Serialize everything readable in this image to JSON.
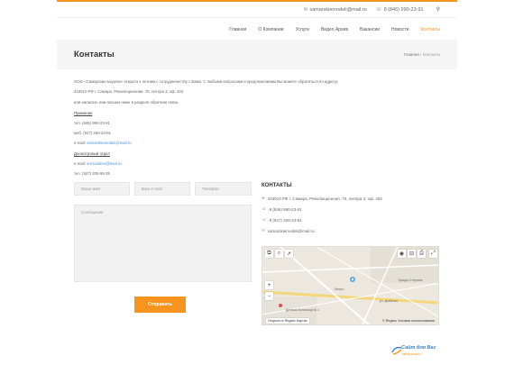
{
  "colors": {
    "accent": "#f7941d",
    "link": "#4a90d9",
    "heading": "#333333"
  },
  "topbar": {
    "email": "samarskiemodeli@mail.ru",
    "phone": "8 (846) 990-23-91",
    "email_icon": "envelope-icon",
    "phone_icon": "phone-icon",
    "search_icon": "search-icon"
  },
  "nav": {
    "items": [
      {
        "label": "Главная"
      },
      {
        "label": "О Компании"
      },
      {
        "label": "Услуги"
      },
      {
        "label": "Видео Архив"
      },
      {
        "label": "Вакансии"
      },
      {
        "label": "Новости"
      },
      {
        "label": "Контакты"
      }
    ],
    "active_index": 6
  },
  "page": {
    "title": "Контакты",
    "breadcrumb": {
      "home": "Главная",
      "separator": "/",
      "current": "Контакты"
    }
  },
  "content": {
    "intro": "ООО «Самарские модели» открыто к летним с сотрудничеству с Вами. С любыми вопросами и предложениями Вы можете обратиться по адресу:",
    "address": "443010 РФ г. Самара, Революционная, 70, литера 3, оф. 402",
    "write_hint": "или написать нам письмо ниже в разделе обратная связь.",
    "section1_title": "Приемная",
    "tel1": "тел. (846) 990-23-91",
    "mob1": "моб. (927) 260-23-91",
    "email1_prefix": "e-mail:",
    "email1": "samarskiemodeli@mail.ru",
    "section2_title": "Досмотровый отдел",
    "email2_prefix": "e-mail:",
    "email2": "vrn.landers@mail.ru",
    "tel2": "тел. (927) 205-99-35"
  },
  "form": {
    "name_placeholder": "Ваше имя",
    "email_placeholder": "Ваш e-mail",
    "phone_placeholder": "Телефон",
    "message_placeholder": "Сообщение",
    "submit_label": "Отправить"
  },
  "contacts": {
    "title": "КОНТАКТЫ",
    "address": "443010 РФ г. Самара, Революционная, 70, литера 3, оф. 402",
    "phone1": "8 (846) 990-23-91",
    "phone2": "8 (927) 260-23-91",
    "email": "samarskiemodeli@mail.ru"
  },
  "map": {
    "open_label": "Открыть в Яндекс.Картах",
    "copyright": "© Яндекс Условия использования",
    "labels": {
      "metro": "Метро",
      "street": "ул. Дыбенко",
      "building": "Детская больница № 1",
      "trk": "Триада Стерлинг"
    }
  },
  "footer": {
    "logo_title": "Сайт для Вас",
    "logo_sub": "sitedlyavas.ru"
  }
}
